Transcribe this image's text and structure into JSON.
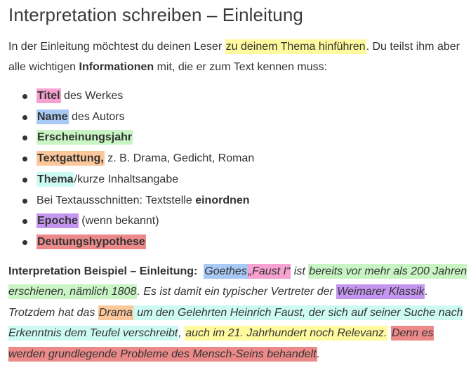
{
  "title": "Interpretation schreiben – Einleitung",
  "colors": {
    "yellow": "#fffa9e",
    "pink": "#f7a1d0",
    "blue": "#a7c9f4",
    "green": "#c9f5c4",
    "orange": "#fcc79a",
    "cyan": "#cdfbf4",
    "purple": "#c596ef",
    "red": "#ec8a8a"
  },
  "intro": {
    "t1": "In der Einleitung möchtest du deinen Leser ",
    "hl": "zu deinem Thema hinführen",
    "t2": ". Du teilst ihm aber alle wichtigen ",
    "bold": "Informationen",
    "t3": " mit, die er zum Text kennen muss:"
  },
  "list": [
    {
      "hl": "Titel",
      "rest": " des Werkes"
    },
    {
      "hl": "Name",
      "rest": " des Autors"
    },
    {
      "hl": "Erscheinungsjahr",
      "rest": ""
    },
    {
      "hl": "Textgattung,",
      "rest": " z. B. Drama, Gedicht, Roman"
    },
    {
      "hl": "Thema",
      "rest": "/kurze Inhaltsangabe"
    },
    {
      "pre": "Bei Textausschnitten: Textstelle ",
      "bold": "einordnen"
    },
    {
      "hl": "Epoche",
      "rest": " (wenn bekannt)"
    },
    {
      "hl": "Deutungshypothese",
      "rest": ""
    }
  ],
  "example": {
    "label": "Interpretation Beispiel – Einleitung:",
    "p1": "Goethes",
    "p2": "„Faust I“",
    "p3": " ist ",
    "p4": "bereits vor mehr als 200 Jahren erschienen, nämlich 1808",
    "p5": ". Es ist damit ein typischer Vertreter der ",
    "p6": "Weimarer Klassik",
    "p7": ". Trotzdem hat das ",
    "p8": "Drama",
    "p9": " um den Gelehrten Heinrich Faust, der sich auf seiner Suche nach Erkenntnis dem Teufel verschreibt",
    "p10": ", ",
    "p11": "auch im 21. Jahrhundert noch Relevanz.",
    "p12": "Denn es werden grundlegende Probleme des Mensch-Seins behandelt",
    "p13": "."
  }
}
